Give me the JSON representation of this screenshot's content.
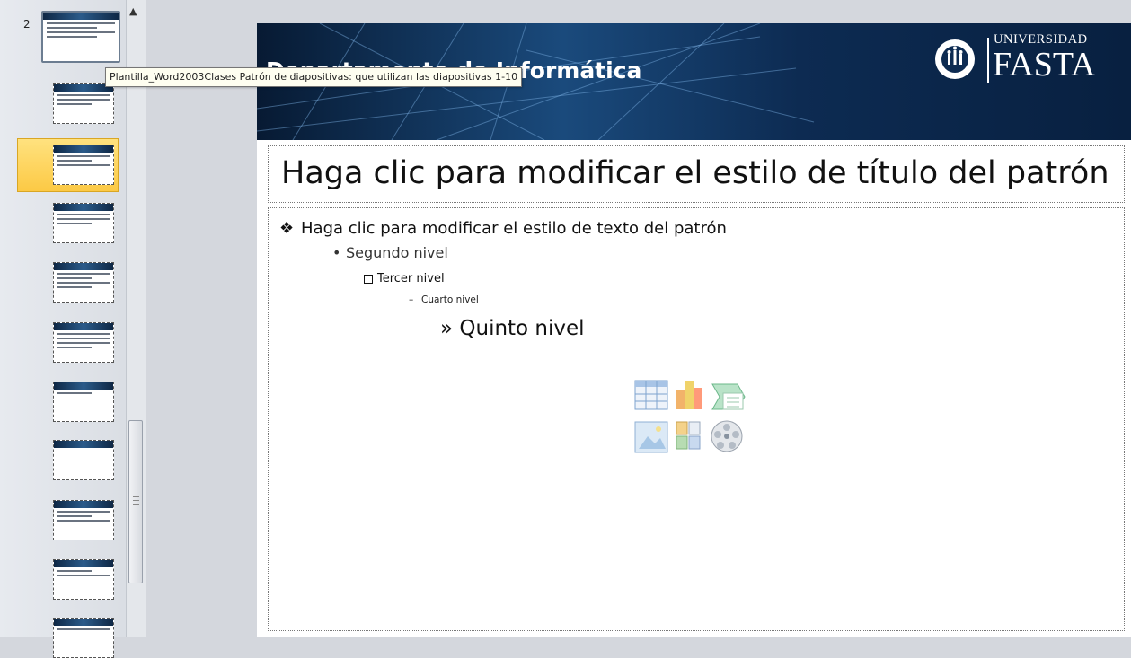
{
  "thumbnail_pane": {
    "slide_number": "2",
    "scroll_up_glyph": "▲",
    "selected_index": 2,
    "thumbnail_count": 11
  },
  "tooltip": {
    "text": "Plantilla_Word2003Clases Patrón de diapositivas: que utilizan las diapositivas 1-10"
  },
  "slide": {
    "header_title": "Departamento de Informática",
    "logo": {
      "top_line": "UNIVERSIDAD",
      "name": "FASTA"
    },
    "title_placeholder": "Haga clic para modificar el estilo de título del patrón",
    "body": {
      "level1": "Haga clic para modificar el estilo de texto del patrón",
      "level1_bullet": "❖",
      "level2": "Segundo nivel",
      "level2_bullet": "•",
      "level3": "Tercer nivel",
      "level4": "Cuarto nivel",
      "level4_bullet": "–",
      "level5": "» Quinto nivel"
    },
    "insert_icons": [
      "insert-table-icon",
      "insert-chart-icon",
      "insert-smartart-icon",
      "insert-picture-icon",
      "insert-clipart-icon",
      "insert-media-icon"
    ]
  },
  "colors": {
    "header_dark": "#071a33",
    "header_mid": "#1a4a7c",
    "selection_fill": "#fcc945",
    "tooltip_bg": "#fefef0"
  }
}
